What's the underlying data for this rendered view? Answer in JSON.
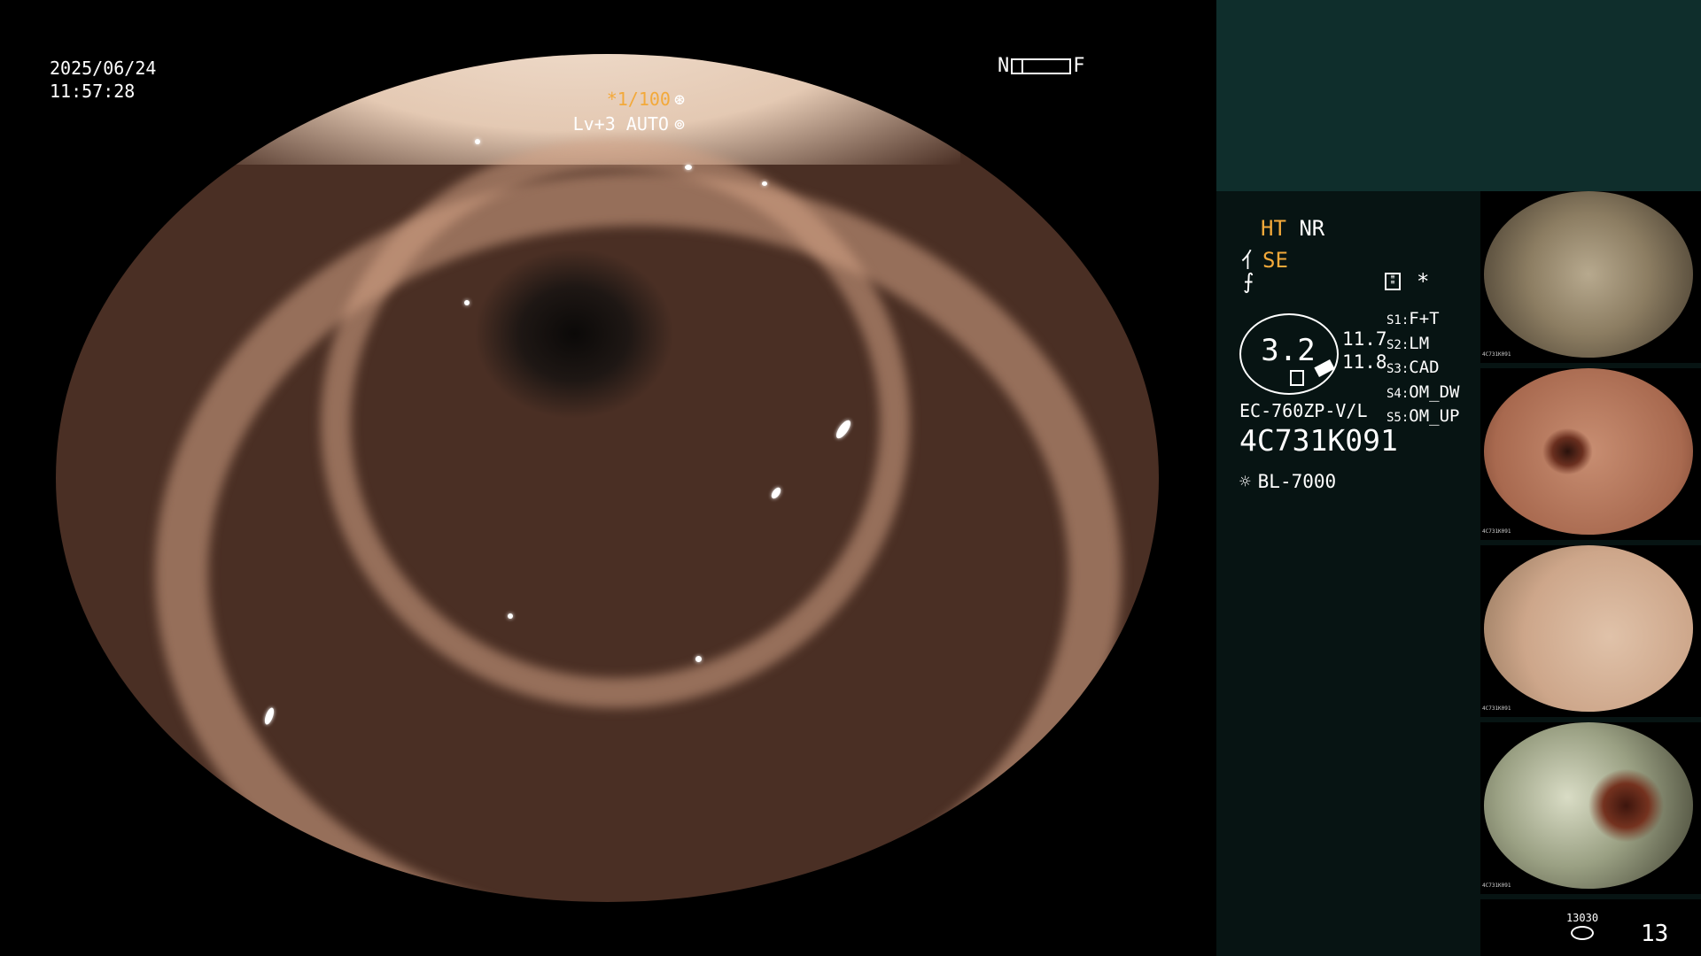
{
  "overlay": {
    "date": "2025/06/24",
    "time": "11:57:28",
    "nf_left": "N",
    "nf_right": "F",
    "shutter": "*1/100",
    "shutter_icon": "⊛",
    "iris": "Lv+3 AUTO",
    "iris_icon": "⊚"
  },
  "panel": {
    "ht": "HT",
    "nr": "NR",
    "se_icon": "⺅",
    "se": "SE",
    "f_icon": "⨍",
    "star": "*",
    "zoom": "3.2",
    "values": [
      "11.7",
      "11.8"
    ],
    "scenes": [
      {
        "key": "S1:",
        "value": "F+T"
      },
      {
        "key": "S2:",
        "value": "LM"
      },
      {
        "key": "S3:",
        "value": "CAD"
      },
      {
        "key": "S4:",
        "value": "OM_DW"
      },
      {
        "key": "S5:",
        "value": "OM_UP"
      }
    ],
    "scope_model": "EC-760ZP-V/L",
    "scope_serial": "4C731K091",
    "light_icon": "☼",
    "light_source": "BL-7000"
  },
  "thumbnails": [
    {
      "label": "4C731K091"
    },
    {
      "label": "4C731K091"
    },
    {
      "label": "4C731K091"
    },
    {
      "label": "4C731K091"
    }
  ],
  "status": {
    "storage_count": "13030",
    "image_count": "13"
  },
  "colors": {
    "accent": "#f3a93a",
    "panel_top": "#0f2e2c",
    "panel": "#071413"
  }
}
